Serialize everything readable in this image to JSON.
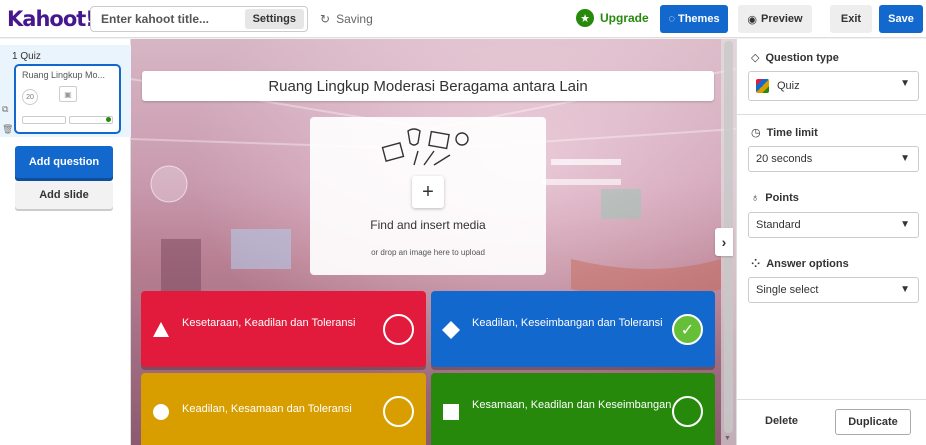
{
  "topbar": {
    "logo": "Kahoot!",
    "title_placeholder": "Enter kahoot title...",
    "settings_label": "Settings",
    "saving_label": "Saving",
    "upgrade_label": "Upgrade",
    "themes_label": "Themes",
    "preview_label": "Preview",
    "exit_label": "Exit",
    "save_label": "Save"
  },
  "sidebar": {
    "slide_number": "1",
    "slide_type": "Quiz",
    "slide_title": "Ruang Lingkup Mo...",
    "thumb_time": "20",
    "add_question_label": "Add question",
    "add_slide_label": "Add slide"
  },
  "question": {
    "title": "Ruang Lingkup Moderasi Beragama antara Lain",
    "media_label": "Find and insert media",
    "media_sub": "or drop an image here to upload"
  },
  "answers": [
    {
      "text": "Kesetaraan, Keadilan dan Toleransi",
      "shape": "triangle",
      "correct": false,
      "color": "#e21b3c"
    },
    {
      "text": "Keadilan, Keseimbangan dan Toleransi",
      "shape": "diamond",
      "correct": true,
      "color": "#1368ce"
    },
    {
      "text": "Keadilan, Kesamaan dan Toleransi",
      "shape": "circle",
      "correct": false,
      "color": "#d89e00"
    },
    {
      "text": "Kesamaan, Keadilan dan Keseimbangan",
      "shape": "square",
      "correct": false,
      "color": "#26890c"
    }
  ],
  "panel": {
    "question_type_label": "Question type",
    "question_type_value": "Quiz",
    "time_limit_label": "Time limit",
    "time_limit_value": "20 seconds",
    "points_label": "Points",
    "points_value": "Standard",
    "answer_options_label": "Answer options",
    "answer_options_value": "Single select",
    "delete_label": "Delete",
    "duplicate_label": "Duplicate"
  }
}
